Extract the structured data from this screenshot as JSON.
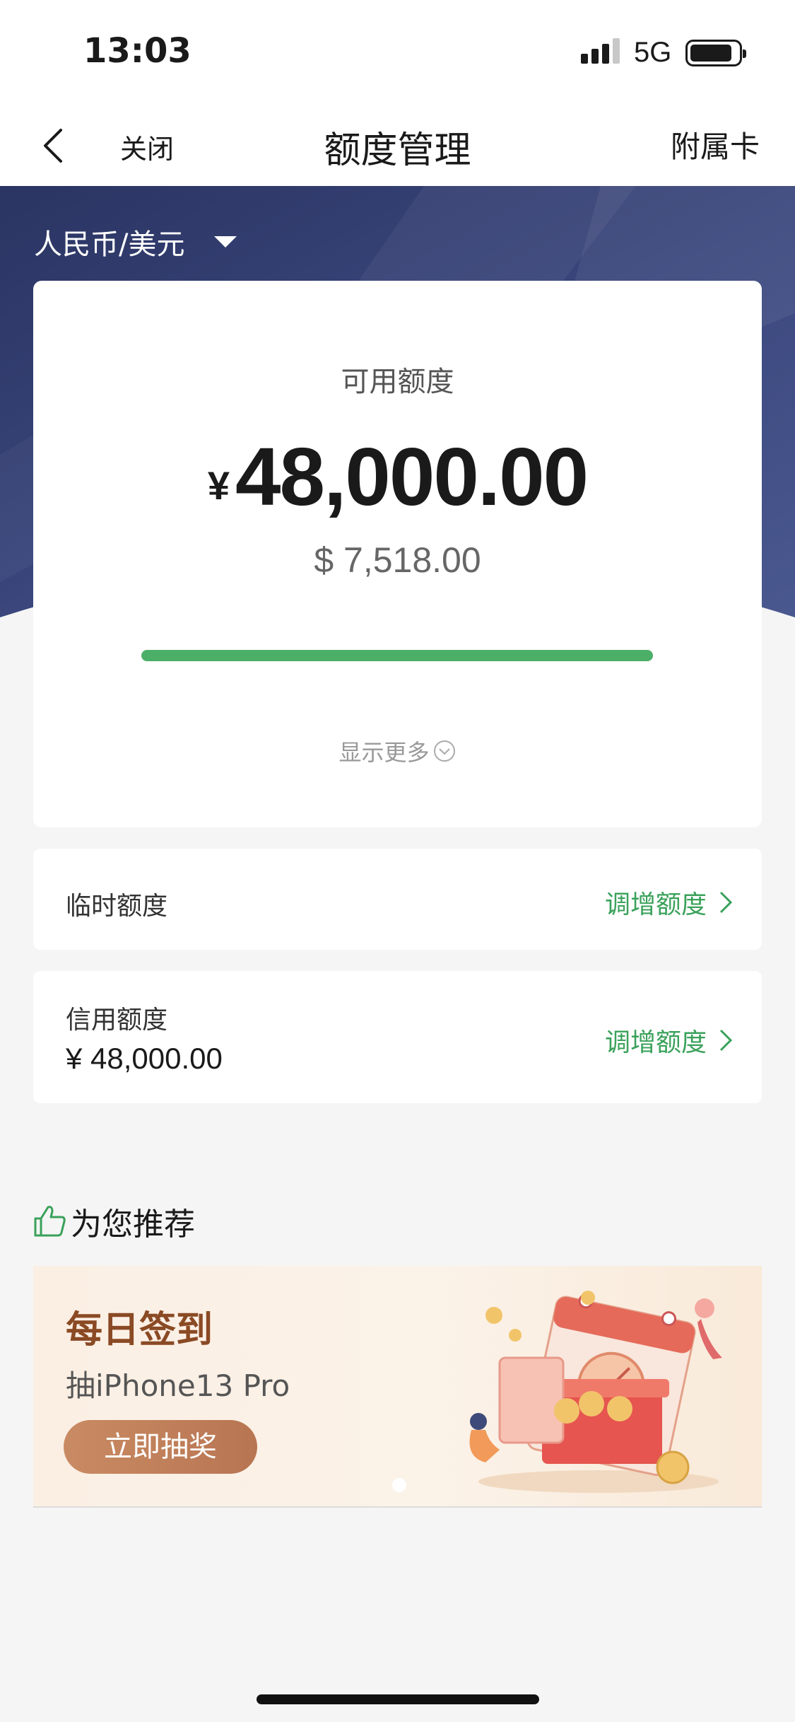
{
  "status_bar": {
    "time": "13:03",
    "network": "5G"
  },
  "nav": {
    "close_label": "关闭",
    "title": "额度管理",
    "right_label": "附属卡"
  },
  "currency_selector": {
    "label": "人民币/美元"
  },
  "available": {
    "label": "可用额度",
    "cny_symbol": "¥",
    "cny_amount": "48,000.00",
    "usd_amount": "$ 7,518.00",
    "progress_fraction": 1.0,
    "show_more": "显示更多"
  },
  "temp_limit": {
    "label": "临时额度",
    "action": "调增额度"
  },
  "credit_limit": {
    "label": "信用额度",
    "value": "¥ 48,000.00",
    "action": "调增额度"
  },
  "recommend": {
    "title": "为您推荐",
    "banner": {
      "title": "每日签到",
      "subtitle": "抽iPhone13 Pro",
      "button": "立即抽奖"
    }
  },
  "colors": {
    "accent_green": "#3aa15a",
    "progress_green": "#4caf68",
    "hero_navy": "#2f3a6b"
  }
}
